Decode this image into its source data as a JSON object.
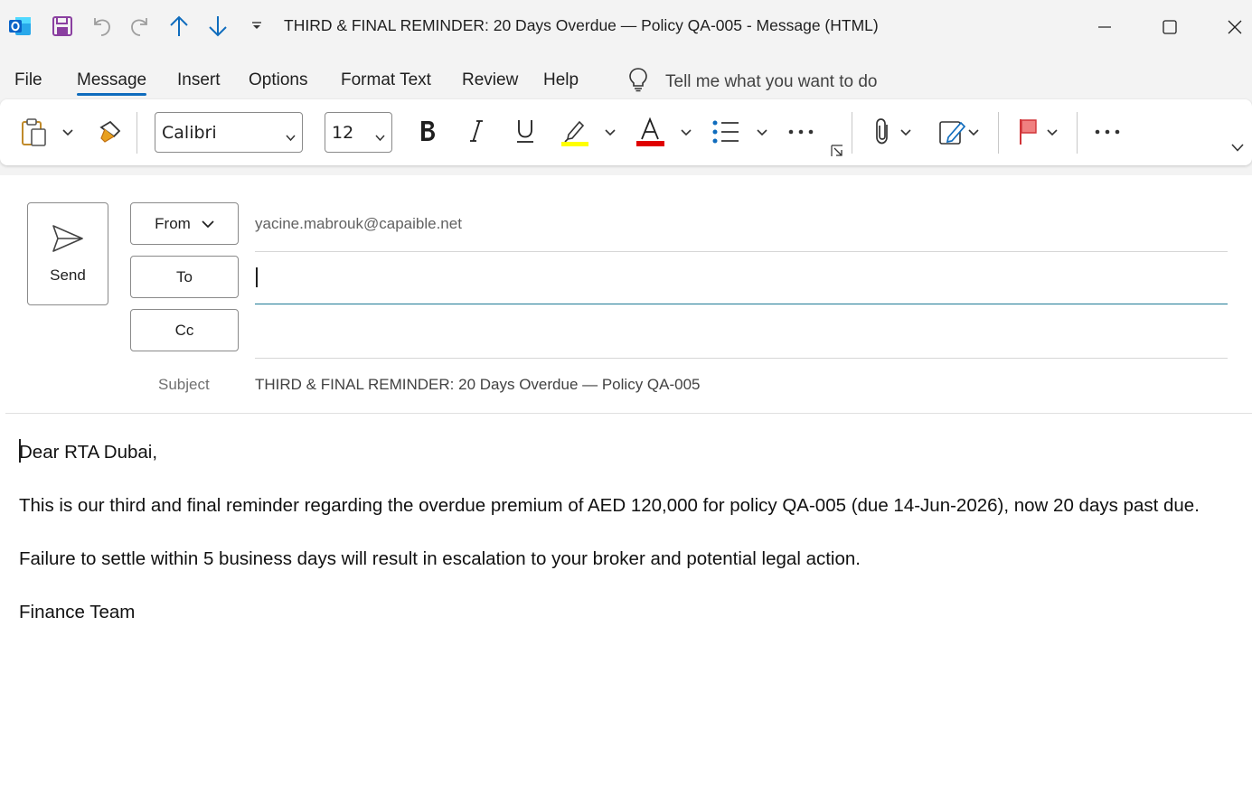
{
  "window": {
    "title": "THIRD & FINAL REMINDER: 20 Days Overdue — Policy QA-005  -  Message (HTML)"
  },
  "tabs": [
    {
      "label": "File"
    },
    {
      "label": "Message",
      "active": true
    },
    {
      "label": "Insert"
    },
    {
      "label": "Options"
    },
    {
      "label": "Format Text"
    },
    {
      "label": "Review"
    },
    {
      "label": "Help"
    }
  ],
  "tellme": {
    "text": "Tell me what you want to do"
  },
  "ribbon": {
    "font_name": "Calibri",
    "font_size": "12",
    "highlight_color": "#ffff00",
    "font_color": "#e00000"
  },
  "compose": {
    "send_label": "Send",
    "from_label": "From",
    "from_value": "yacine.mabrouk@capaible.net",
    "to_label": "To",
    "to_value": "",
    "cc_label": "Cc",
    "cc_value": "",
    "subject_label": "Subject",
    "subject_value": "THIRD & FINAL REMINDER: 20 Days Overdue — Policy QA-005"
  },
  "body": {
    "greeting": "Dear RTA Dubai,",
    "paragraph1": "This is our third and final reminder regarding the overdue premium of AED 120,000 for policy QA-005 (due 14-Jun-2026), now 20 days past due.",
    "paragraph2": "Failure to settle within 5 business days will result in escalation to your broker and potential legal action.",
    "signature": "Finance Team"
  },
  "colors": {
    "accent": "#0f6cbd",
    "outlook_blue": "#0a64c8",
    "save_purple": "#8a3fa0",
    "flag_red": "#d13438"
  }
}
